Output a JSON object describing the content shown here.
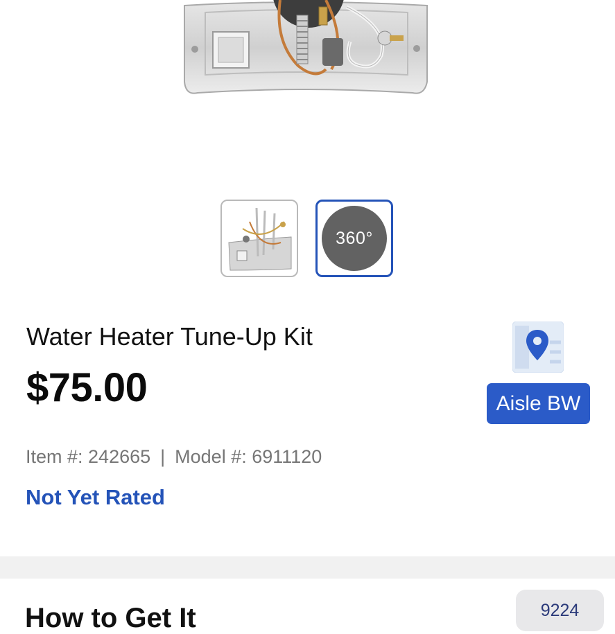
{
  "product": {
    "title": "Water Heater Tune-Up Kit",
    "price": "$75.00",
    "item_label": "Item #: 242665",
    "separator": "|",
    "model_label": "Model #: 6911120",
    "rating_text": "Not Yet Rated"
  },
  "gallery": {
    "badge_360": "360°"
  },
  "location": {
    "aisle_label": "Aisle BW",
    "icon": "map-pin-icon",
    "accent_color": "#2b5bc8"
  },
  "next_section": {
    "heading": "How to Get It",
    "store_number": "9224"
  }
}
